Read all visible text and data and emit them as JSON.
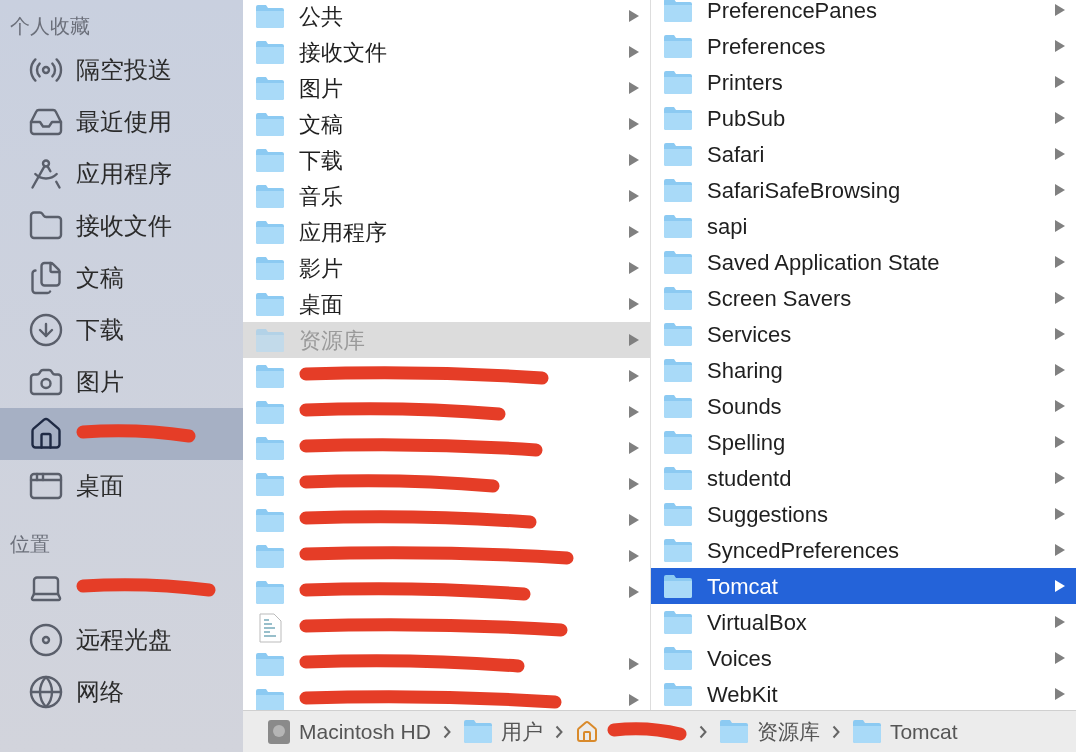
{
  "sidebar": {
    "sections": [
      {
        "title": "个人收藏",
        "items": [
          {
            "label": "隔空投送",
            "selected": false,
            "redacted": false
          },
          {
            "label": "最近使用",
            "selected": false,
            "redacted": false
          },
          {
            "label": "应用程序",
            "selected": false,
            "redacted": false
          },
          {
            "label": "接收文件",
            "selected": false,
            "redacted": false
          },
          {
            "label": "文稿",
            "selected": false,
            "redacted": false
          },
          {
            "label": "下载",
            "selected": false,
            "redacted": false
          },
          {
            "label": "图片",
            "selected": false,
            "redacted": false
          },
          {
            "selected": true,
            "redacted": true
          },
          {
            "label": "桌面",
            "selected": false,
            "redacted": false
          }
        ]
      },
      {
        "title": "位置",
        "items": [
          {
            "selected": false,
            "redacted": true
          },
          {
            "label": "远程光盘",
            "selected": false,
            "redacted": false
          },
          {
            "label": "网络",
            "selected": false,
            "redacted": false
          }
        ]
      }
    ]
  },
  "columns": [
    {
      "active": false,
      "items": [
        {
          "label": "公共",
          "kind": "folder",
          "selected": false,
          "dimmed": false,
          "redacted": false
        },
        {
          "label": "接收文件",
          "kind": "folder",
          "selected": false,
          "dimmed": false,
          "redacted": false
        },
        {
          "label": "图片",
          "kind": "folder",
          "selected": false,
          "dimmed": false,
          "redacted": false
        },
        {
          "label": "文稿",
          "kind": "folder",
          "selected": false,
          "dimmed": false,
          "redacted": false
        },
        {
          "label": "下载",
          "kind": "folder",
          "selected": false,
          "dimmed": false,
          "redacted": false
        },
        {
          "label": "音乐",
          "kind": "folder",
          "selected": false,
          "dimmed": false,
          "redacted": false
        },
        {
          "label": "应用程序",
          "kind": "folder",
          "selected": false,
          "dimmed": false,
          "redacted": false
        },
        {
          "label": "影片",
          "kind": "folder",
          "selected": false,
          "dimmed": false,
          "redacted": false
        },
        {
          "label": "桌面",
          "kind": "folder",
          "selected": false,
          "dimmed": false,
          "redacted": false
        },
        {
          "label": "资源库",
          "kind": "folder",
          "selected": true,
          "dimmed": true,
          "redacted": false
        },
        {
          "kind": "folder",
          "selected": false,
          "dimmed": false,
          "redacted": true
        },
        {
          "kind": "folder",
          "selected": false,
          "dimmed": false,
          "redacted": true
        },
        {
          "kind": "folder",
          "selected": false,
          "dimmed": false,
          "redacted": true
        },
        {
          "kind": "folder",
          "selected": false,
          "dimmed": false,
          "redacted": true
        },
        {
          "kind": "folder",
          "selected": false,
          "dimmed": false,
          "redacted": true
        },
        {
          "kind": "folder",
          "selected": false,
          "dimmed": false,
          "redacted": true
        },
        {
          "kind": "folder",
          "selected": false,
          "dimmed": false,
          "redacted": true
        },
        {
          "kind": "document",
          "selected": false,
          "dimmed": false,
          "redacted": true
        },
        {
          "kind": "folder",
          "selected": false,
          "dimmed": false,
          "redacted": true
        },
        {
          "kind": "folder",
          "selected": false,
          "dimmed": false,
          "redacted": true
        }
      ]
    },
    {
      "active": true,
      "items": [
        {
          "label": "PreferencePanes",
          "kind": "folder",
          "selected": false,
          "dimmed": false,
          "redacted": false
        },
        {
          "label": "Preferences",
          "kind": "folder",
          "selected": false,
          "dimmed": false,
          "redacted": false
        },
        {
          "label": "Printers",
          "kind": "folder",
          "selected": false,
          "dimmed": false,
          "redacted": false
        },
        {
          "label": "PubSub",
          "kind": "folder",
          "selected": false,
          "dimmed": false,
          "redacted": false
        },
        {
          "label": "Safari",
          "kind": "folder",
          "selected": false,
          "dimmed": false,
          "redacted": false
        },
        {
          "label": "SafariSafeBrowsing",
          "kind": "folder",
          "selected": false,
          "dimmed": false,
          "redacted": false
        },
        {
          "label": "sapi",
          "kind": "folder",
          "selected": false,
          "dimmed": false,
          "redacted": false
        },
        {
          "label": "Saved Application State",
          "kind": "folder",
          "selected": false,
          "dimmed": false,
          "redacted": false
        },
        {
          "label": "Screen Savers",
          "kind": "folder",
          "selected": false,
          "dimmed": false,
          "redacted": false
        },
        {
          "label": "Services",
          "kind": "folder",
          "selected": false,
          "dimmed": false,
          "redacted": false
        },
        {
          "label": "Sharing",
          "kind": "folder",
          "selected": false,
          "dimmed": false,
          "redacted": false
        },
        {
          "label": "Sounds",
          "kind": "folder",
          "selected": false,
          "dimmed": false,
          "redacted": false
        },
        {
          "label": "Spelling",
          "kind": "folder",
          "selected": false,
          "dimmed": false,
          "redacted": false
        },
        {
          "label": "studentd",
          "kind": "folder",
          "selected": false,
          "dimmed": false,
          "redacted": false
        },
        {
          "label": "Suggestions",
          "kind": "folder",
          "selected": false,
          "dimmed": false,
          "redacted": false
        },
        {
          "label": "SyncedPreferences",
          "kind": "folder",
          "selected": false,
          "dimmed": false,
          "redacted": false
        },
        {
          "label": "Tomcat",
          "kind": "folder",
          "selected": true,
          "dimmed": false,
          "redacted": false
        },
        {
          "label": "VirtualBox",
          "kind": "folder",
          "selected": false,
          "dimmed": false,
          "redacted": false
        },
        {
          "label": "Voices",
          "kind": "folder",
          "selected": false,
          "dimmed": false,
          "redacted": false
        },
        {
          "label": "WebKit",
          "kind": "folder",
          "selected": false,
          "dimmed": false,
          "redacted": false
        }
      ]
    }
  ],
  "path_bar": [
    {
      "label": "Macintosh HD",
      "kind": "disk",
      "redacted": false
    },
    {
      "label": "用户",
      "kind": "folder",
      "redacted": false
    },
    {
      "kind": "home",
      "redacted": true
    },
    {
      "label": "资源库",
      "kind": "folder",
      "redacted": false
    },
    {
      "label": "Tomcat",
      "kind": "folder",
      "redacted": false
    }
  ]
}
